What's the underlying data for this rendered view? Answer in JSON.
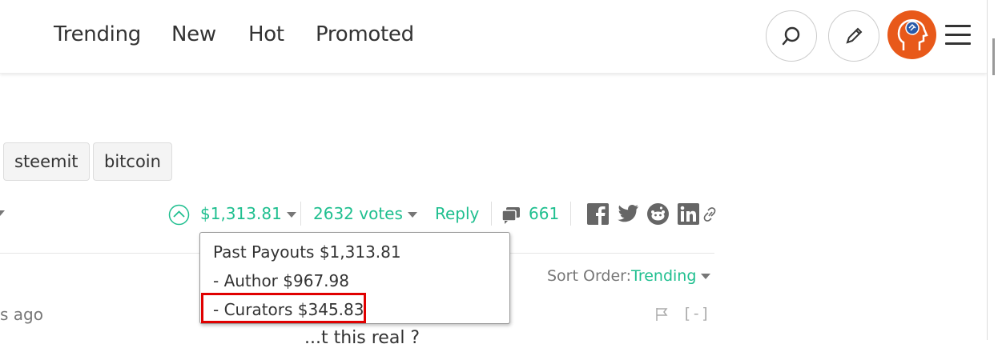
{
  "nav": {
    "items": [
      "Trending",
      "New",
      "Hot",
      "Promoted"
    ]
  },
  "tags": [
    "steemit",
    "bitcoin"
  ],
  "post": {
    "payout": "$1,313.81",
    "votes": "2632 votes",
    "reply": "Reply",
    "comments": "661"
  },
  "tooltip": {
    "line1": "Past Payouts $1,313.81",
    "line2": "- Author $967.98",
    "line3": "- Curators $345.83"
  },
  "sort": {
    "label": "Sort Order:",
    "value": "Trending"
  },
  "comment": {
    "time_fragment": "s ago",
    "collapse": "[-]",
    "body_fragment": "...t this real ?"
  },
  "icons": [
    "search-icon",
    "pencil-icon",
    "avatar",
    "hamburger-icon",
    "upvote-icon",
    "comments-icon",
    "facebook-icon",
    "twitter-icon",
    "reddit-icon",
    "linkedin-icon",
    "link-icon",
    "flag-icon"
  ],
  "colors": {
    "accent": "#1fbf8f",
    "highlight": "#e00000",
    "avatar": "#e8591a"
  }
}
